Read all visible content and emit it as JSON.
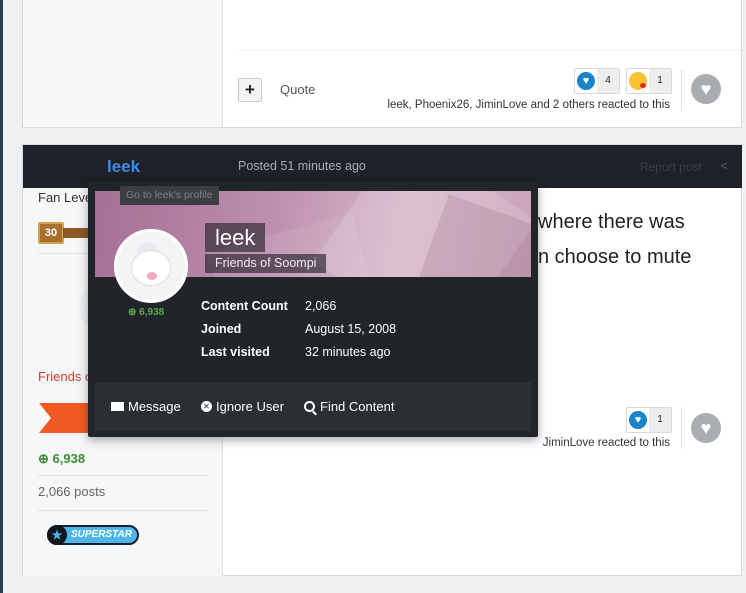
{
  "post1": {
    "quote_label": "Quote",
    "plus_label": "+",
    "reactions": [
      {
        "type": "like",
        "count": "4"
      },
      {
        "type": "kiss",
        "count": "1"
      }
    ],
    "reacted_text": "leek, Phoenix26, JiminLove and 2 others reacted to this"
  },
  "post2": {
    "author": "leek",
    "posted": "Posted 51 minutes ago",
    "report_label": "Report post",
    "sidebar": {
      "group_partial": "Fan Leve",
      "level": "30",
      "friends_partial": "Friends o",
      "reputation": "6,938",
      "posts_count": "2,066 posts",
      "badge_label": "SUPERSTAR"
    },
    "body_lines": [
      "where there was",
      "n choose to mute"
    ],
    "reactions": [
      {
        "type": "like",
        "count": "1"
      }
    ],
    "reacted_text": "JiminLove reacted to this"
  },
  "hovercard": {
    "go_profile": "Go to leek's profile",
    "name": "leek",
    "group": "Friends of Soompi",
    "reputation": "6,938",
    "stats": [
      {
        "label": "Content Count",
        "value": "2,066"
      },
      {
        "label": "Joined",
        "value": "August 15, 2008"
      },
      {
        "label": "Last visited",
        "value": "32 minutes ago"
      }
    ],
    "actions": {
      "message": "Message",
      "ignore": "Ignore User",
      "find": "Find Content"
    }
  },
  "colors": {
    "header_dark": "#1e2127",
    "link_blue": "#3d8de6",
    "rep_green": "#3f8b3a",
    "card_bg": "#212429"
  }
}
